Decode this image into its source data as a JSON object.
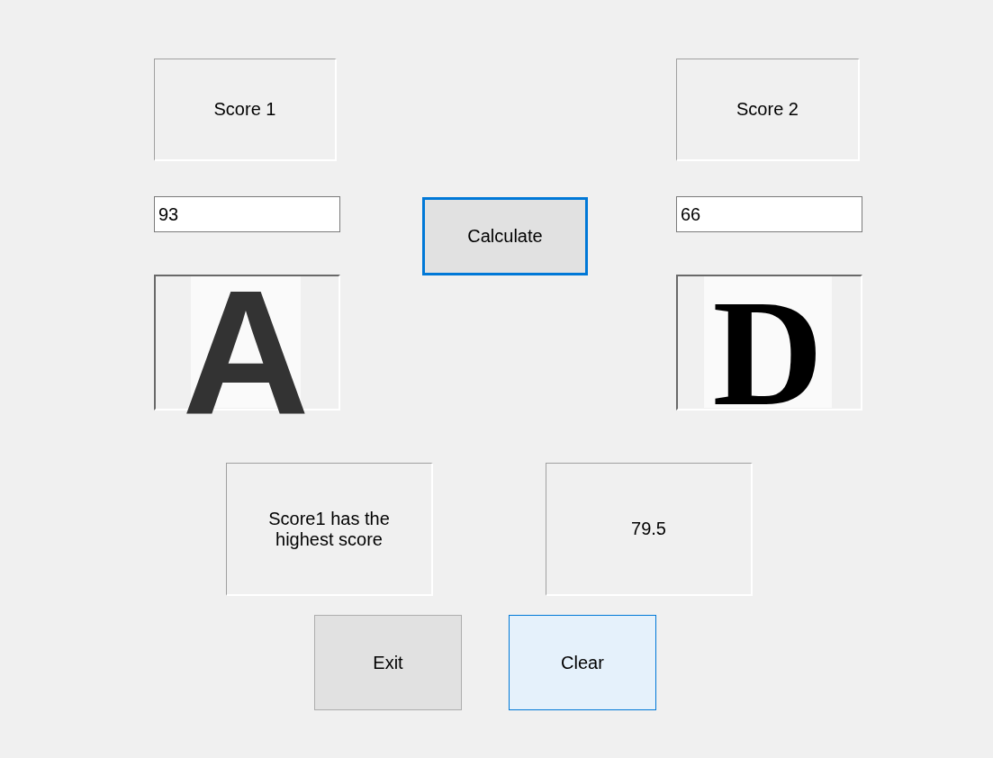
{
  "scores": [
    {
      "label": "Score 1",
      "value": "93",
      "grade": "A",
      "kind": "rounded"
    },
    {
      "label": "Score 2",
      "value": "66",
      "grade": "D",
      "kind": "serif"
    }
  ],
  "calculate_button": {
    "label": "Calculate",
    "focused": true,
    "hovered": false
  },
  "result_message": "Score1 has the highest score",
  "average": "79.5",
  "buttons": [
    {
      "label": "Exit",
      "focused": false,
      "hovered": false
    },
    {
      "label": "Clear",
      "focused": false,
      "hovered": true
    }
  ]
}
